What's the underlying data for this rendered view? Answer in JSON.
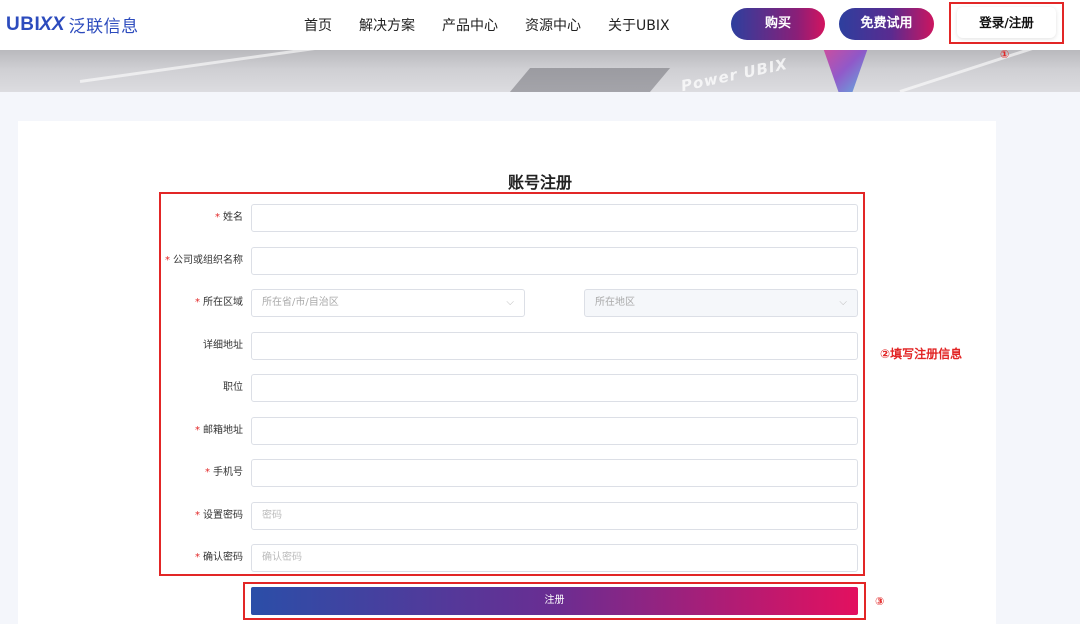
{
  "header": {
    "logo_en": "UBI",
    "logo_xx": "XX",
    "logo_cn": "泛联信息",
    "nav": [
      "首页",
      "解决方案",
      "产品中心",
      "资源中心",
      "关于UBIX"
    ],
    "buy_label": "购买",
    "trial_label": "免费试用",
    "login_label": "登录/注册",
    "step1_mark": "①"
  },
  "banner": {
    "text": "Power  UBIX"
  },
  "form": {
    "title": "账号注册",
    "step2_mark": "②填写注册信息",
    "step3_mark": "③",
    "required_mark": "*",
    "fields": [
      {
        "label": "姓名",
        "required": true,
        "placeholder": ""
      },
      {
        "label": "公司或组织名称",
        "required": true,
        "placeholder": ""
      },
      {
        "label": "所在区域",
        "required": true,
        "province_placeholder": "所在省/市/自治区",
        "city_placeholder": "所在地区"
      },
      {
        "label": "详细地址",
        "required": false,
        "placeholder": ""
      },
      {
        "label": "职位",
        "required": false,
        "placeholder": ""
      },
      {
        "label": "邮箱地址",
        "required": true,
        "placeholder": ""
      },
      {
        "label": "手机号",
        "required": true,
        "placeholder": ""
      },
      {
        "label": "设置密码",
        "required": true,
        "placeholder": "密码"
      },
      {
        "label": "确认密码",
        "required": true,
        "placeholder": "确认密码"
      }
    ],
    "submit_label": "注册"
  },
  "colors": {
    "brand_blue": "#2c4bbd",
    "annotation_red": "#e22626",
    "gradient_start": "#2b4ea8",
    "gradient_end": "#e3105f"
  }
}
